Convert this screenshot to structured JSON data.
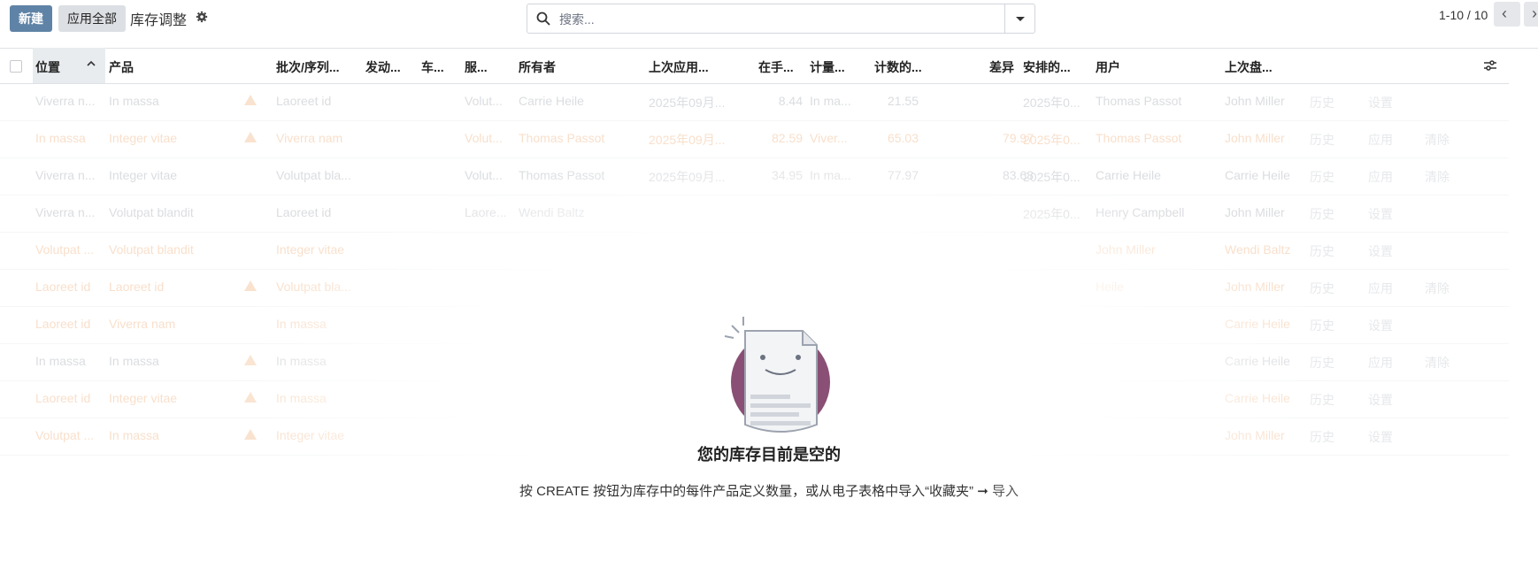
{
  "toolbar": {
    "new_label": "新建",
    "apply_all_label": "应用全部",
    "title": "库存调整",
    "search_placeholder": "搜索...",
    "pager_text": "1-10 / 10"
  },
  "columns": [
    "位置",
    "产品",
    "批次/序列...",
    "发动...",
    "车...",
    "服...",
    "所有者",
    "上次应用...",
    "在手...",
    "计量...",
    "计数的...",
    "差异",
    "安排的...",
    "用户",
    "上次盘..."
  ],
  "rows": [
    {
      "status": "gray",
      "warn": true,
      "cells": [
        "Viverra n...",
        "In massa",
        "Laoreet id",
        "",
        "",
        "Volut...",
        "Carrie Heile",
        "2025年09月...",
        "8.44",
        "In ma...",
        "21.55",
        "",
        "2025年0...",
        "Thomas Passot",
        "John Miller"
      ],
      "actions": [
        "历史",
        "设置"
      ]
    },
    {
      "status": "warn",
      "warn": true,
      "cells": [
        "In massa",
        "Integer vitae",
        "Viverra nam",
        "",
        "",
        "Volut...",
        "Thomas Passot",
        "2025年09月...",
        "82.59",
        "Viver...",
        "65.03",
        "79.97",
        "2025年0...",
        "Thomas Passot",
        "John Miller"
      ],
      "actions": [
        "历史",
        "应用",
        "清除"
      ]
    },
    {
      "status": "gray",
      "warn": false,
      "cells": [
        "Viverra n...",
        "Integer vitae",
        "Volutpat bla...",
        "",
        "",
        "Volut...",
        "Thomas Passot",
        "2025年09月...",
        "34.95",
        "In ma...",
        "77.97",
        "83.63",
        "2025年0...",
        "Carrie Heile",
        "Carrie Heile"
      ],
      "actions": [
        "历史",
        "应用",
        "清除"
      ]
    },
    {
      "status": "gray",
      "warn": false,
      "cells": [
        "Viverra n...",
        "Volutpat blandit",
        "Laoreet id",
        "",
        "",
        "Laore...",
        "Wendi Baltz",
        "",
        "",
        "",
        "",
        "",
        "2025年0...",
        "Henry Campbell",
        "John Miller"
      ],
      "actions": [
        "历史",
        "设置"
      ]
    },
    {
      "status": "warn",
      "warn": false,
      "cells": [
        "Volutpat ...",
        "Volutpat blandit",
        "Integer vitae",
        "",
        "",
        "",
        "",
        "",
        "",
        "",
        "",
        "",
        "",
        "John Miller",
        "Wendi Baltz"
      ],
      "actions": [
        "历史",
        "设置"
      ]
    },
    {
      "status": "warn",
      "warn": true,
      "cells": [
        "Laoreet id",
        "Laoreet id",
        "Volutpat bla...",
        "",
        "",
        "",
        "",
        "",
        "",
        "",
        "",
        "",
        "",
        "Heile",
        "John Miller"
      ],
      "actions": [
        "历史",
        "应用",
        "清除"
      ]
    },
    {
      "status": "warn",
      "warn": false,
      "cells": [
        "Laoreet id",
        "Viverra nam",
        "In massa",
        "",
        "",
        "",
        "",
        "",
        "",
        "",
        "",
        "",
        "",
        "",
        "Carrie Heile"
      ],
      "actions": [
        "历史",
        "设置"
      ]
    },
    {
      "status": "gray",
      "warn": true,
      "cells": [
        "In massa",
        "In massa",
        "In massa",
        "",
        "",
        "",
        "",
        "",
        "",
        "",
        "",
        "",
        "",
        "",
        "Carrie Heile"
      ],
      "actions": [
        "历史",
        "应用",
        "清除"
      ]
    },
    {
      "status": "warn",
      "warn": true,
      "cells": [
        "Laoreet id",
        "Integer vitae",
        "In massa",
        "",
        "",
        "",
        "",
        "",
        "",
        "",
        "",
        "",
        "",
        "",
        "Carrie Heile"
      ],
      "actions": [
        "历史",
        "设置"
      ]
    },
    {
      "status": "warn",
      "warn": true,
      "cells": [
        "Volutpat ...",
        "In massa",
        "Integer vitae",
        "",
        "",
        "",
        "",
        "",
        "",
        "",
        "",
        "",
        "",
        "",
        "John Miller"
      ],
      "actions": [
        "历史",
        "设置"
      ]
    }
  ],
  "empty_state": {
    "title": "您的库存目前是空的",
    "description": "按 CREATE 按钮为库存中的每件产品定义数量，或从电子表格中导入“收藏夹”",
    "arrow": "➞",
    "import_link": "导入"
  },
  "colors": {
    "primary": "#5f83a6",
    "warning_text": "#f1b98b",
    "illustration_circle": "#8a4f75"
  }
}
